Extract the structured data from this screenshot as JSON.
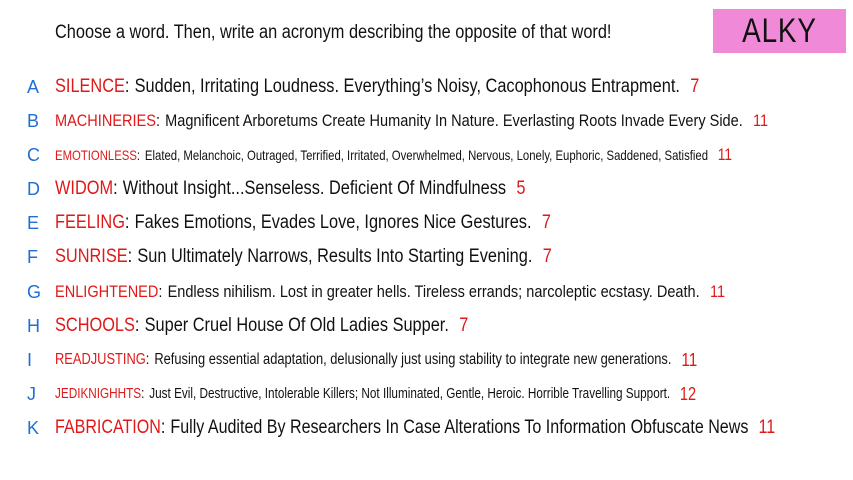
{
  "header": {
    "prompt": "Choose a word. Then, write an acronym describing the opposite of that word!",
    "badge": "ALKY"
  },
  "entries": [
    {
      "letter": "A",
      "word": "SILENCE",
      "acronym": "Sudden, Irritating Loudness. Everything’s Noisy, Cacophonous Entrapment.",
      "count": "7"
    },
    {
      "letter": "B",
      "word": "MACHINERIES",
      "acronym": "Magnificent Arboretums Create Humanity In Nature. Everlasting Roots Invade Every Side.",
      "count": "11"
    },
    {
      "letter": "C",
      "word": "EMOTIONLESS",
      "acronym": "Elated, Melanchoic, Outraged, Terrified, Irritated, Overwhelmed, Nervous, Lonely, Euphoric, Saddened, Satisfied",
      "count": "11"
    },
    {
      "letter": "D",
      "word": "WIDOM",
      "acronym": "Without Insight...Senseless. Deficient Of Mindfulness",
      "count": "5"
    },
    {
      "letter": "E",
      "word": "FEELING",
      "acronym": "Fakes Emotions, Evades Love, Ignores Nice Gestures.",
      "count": "7"
    },
    {
      "letter": "F",
      "word": "SUNRISE",
      "acronym": "Sun Ultimately Narrows, Results Into Starting Evening.",
      "count": "7"
    },
    {
      "letter": "G",
      "word": "ENLIGHTENED",
      "acronym": "Endless nihilism. Lost in greater hells. Tireless errands; narcoleptic ecstasy. Death.",
      "count": "11"
    },
    {
      "letter": "H",
      "word": "SCHOOLS",
      "acronym": "Super Cruel House Of Old Ladies Supper.",
      "count": "7"
    },
    {
      "letter": "I",
      "word": "READJUSTING",
      "acronym": "Refusing essential adaptation, delusionally just using stability to  integrate new generations.",
      "count": "11"
    },
    {
      "letter": "J",
      "word": "JEDIKNIGHHTS",
      "acronym": "Just Evil, Destructive, Intolerable Killers; Not Illuminated, Gentle, Heroic.  Horrible Travelling Support.",
      "count": "12"
    },
    {
      "letter": "K",
      "word": "FABRICATION",
      "acronym": "Fully Audited By Researchers In Case Alterations To Information Obfuscate News",
      "count": "11"
    }
  ]
}
